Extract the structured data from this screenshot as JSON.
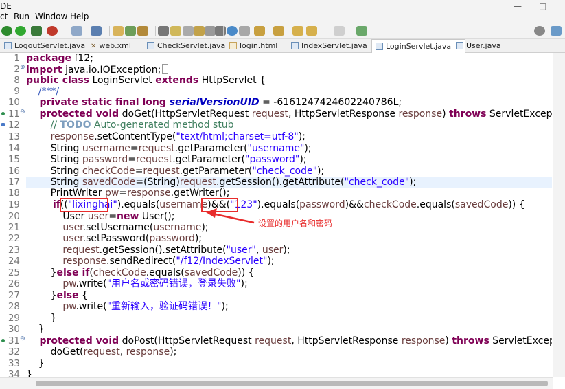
{
  "menubar": {
    "items": [
      "ct",
      "Run",
      "Window",
      "Help"
    ],
    "left_fragment": "DE",
    "winctl_min": "—",
    "winctl_max": "□"
  },
  "tabs": [
    {
      "label": "LogoutServlet.java",
      "icon": "java-file-icon"
    },
    {
      "label": "web.xml",
      "icon": "xml-file-icon"
    },
    {
      "label": "CheckServlet.java",
      "icon": "java-file-icon"
    },
    {
      "label": "login.html",
      "icon": "html-file-icon"
    },
    {
      "label": "IndexServlet.java",
      "icon": "java-file-icon"
    },
    {
      "label": "LoginServlet.java",
      "icon": "java-file-icon",
      "active": true,
      "close": "✕"
    },
    {
      "label": "User.java",
      "icon": "java-file-icon"
    }
  ],
  "gutter": {
    "lines": [
      "1",
      "2",
      "8",
      "9",
      "10",
      "11",
      "12",
      "13",
      "14",
      "15",
      "16",
      "17",
      "18",
      "19",
      "20",
      "21",
      "22",
      "23",
      "24",
      "25",
      "26",
      "27",
      "28",
      "29",
      "30",
      "31",
      "32",
      "33",
      "34"
    ],
    "fold_markers": [
      "⊕",
      "⊖",
      "⊖"
    ]
  },
  "code": {
    "l1_kw": "package",
    "l1_rest": " f12;",
    "l2_kw": "import",
    "l2_rest": " java.io.IOException;",
    "l8_kw1": "public class",
    "l8_mid": " LoginServlet ",
    "l8_kw2": "extends",
    "l8_rest": " HttpServlet {",
    "l9": "    /***/",
    "l10_kw": "    private static final long ",
    "l10_fld": "serialVersionUID",
    "l10_rest": " = -6161247424602240786L;",
    "l11_kw": "    protected void",
    "l11_a": " doGet(HttpServletRequest ",
    "l11_v1": "request",
    "l11_b": ", HttpServletResponse ",
    "l11_v2": "response",
    "l11_c": ") ",
    "l11_kw2": "throws",
    "l11_d": " ServletException, IOExce",
    "l12_cm1": "        // ",
    "l12_todo": "TODO",
    "l12_cm2": " Auto-generated method stub",
    "l13_a": "        ",
    "l13_v": "response",
    "l13_b": ".setContentType(",
    "l13_s": "\"text/html;charset=utf-8\"",
    "l13_c": ");",
    "l14_a": "        String ",
    "l14_v": "username",
    "l14_b": "=",
    "l14_v2": "request",
    "l14_c": ".getParameter(",
    "l14_s": "\"username\"",
    "l14_d": ");",
    "l15_a": "        String ",
    "l15_v": "password",
    "l15_b": "=",
    "l15_v2": "request",
    "l15_c": ".getParameter(",
    "l15_s": "\"password\"",
    "l15_d": ");",
    "l16_a": "        String ",
    "l16_v": "checkCode",
    "l16_b": "=",
    "l16_v2": "request",
    "l16_c": ".getParameter(",
    "l16_s": "\"check_code\"",
    "l16_d": ");",
    "l17_a": "        String ",
    "l17_v": "savedCode",
    "l17_b": "=(String)",
    "l17_v2": "request",
    "l17_c": ".getSession().getAttribute(",
    "l17_s": "\"check_code\"",
    "l17_d": ");",
    "l18_a": "        PrintWriter ",
    "l18_v": "pw",
    "l18_b": "=",
    "l18_v2": "response",
    "l18_c": ".getWriter();",
    "l19_kw": "        if",
    "l19_a": "((",
    "l19_s1": "\"lixinghai\"",
    "l19_b": ").equals(",
    "l19_v1": "username",
    "l19_c": ")&&(",
    "l19_s2": "\"123\"",
    "l19_d": ").equals(",
    "l19_v2": "password",
    "l19_e": ")&&",
    "l19_v3": "checkCode",
    "l19_f": ".equals(",
    "l19_v4": "savedCode",
    "l19_g": ")) {",
    "l20_a": "            User ",
    "l20_v": "user",
    "l20_b": "=",
    "l20_kw": "new",
    "l20_c": " User();",
    "l21_a": "            ",
    "l21_v": "user",
    "l21_b": ".setUsername(",
    "l21_v2": "username",
    "l21_c": ");",
    "l22_a": "            ",
    "l22_v": "user",
    "l22_b": ".setPassword(",
    "l22_v2": "password",
    "l22_c": ");",
    "l23_a": "            ",
    "l23_v": "request",
    "l23_b": ".getSession().setAttribute(",
    "l23_s": "\"user\"",
    "l23_c": ", ",
    "l23_v2": "user",
    "l23_d": ");",
    "l24_a": "            ",
    "l24_v": "response",
    "l24_b": ".sendRedirect(",
    "l24_s": "\"/f12/IndexServlet\"",
    "l24_c": ");",
    "l25_a": "        }",
    "l25_kw": "else if",
    "l25_b": "(",
    "l25_v": "checkCode",
    "l25_c": ".equals(",
    "l25_v2": "savedCode",
    "l25_d": ")) {",
    "l26_a": "            ",
    "l26_v": "pw",
    "l26_b": ".write(",
    "l26_s": "\"用户名或密码错误，登录失败\"",
    "l26_c": ");",
    "l27_a": "        }",
    "l27_kw": "else",
    "l27_b": " {",
    "l28_a": "            ",
    "l28_v": "pw",
    "l28_b": ".write(",
    "l28_s": "\"重新输入，验证码错误！\"",
    "l28_c": ");",
    "l29": "        }",
    "l30": "    }",
    "l31_kw": "    protected void",
    "l31_a": " doPost(HttpServletRequest ",
    "l31_v1": "request",
    "l31_b": ", HttpServletResponse ",
    "l31_v2": "response",
    "l31_c": ") ",
    "l31_kw2": "throws",
    "l31_d": " ServletException, IOExc",
    "l32_a": "        doGet(",
    "l32_v1": "request",
    "l32_b": ", ",
    "l32_v2": "response",
    "l32_c": ");",
    "l33": "    }",
    "l34": "}"
  },
  "annotation": {
    "text": "设置的用户名和密码",
    "color": "#e82c2c"
  },
  "colors": {
    "keyword": "#7f0055",
    "string": "#2a00ff",
    "comment": "#3f7f5f",
    "highlight": "#e8f2fe"
  }
}
